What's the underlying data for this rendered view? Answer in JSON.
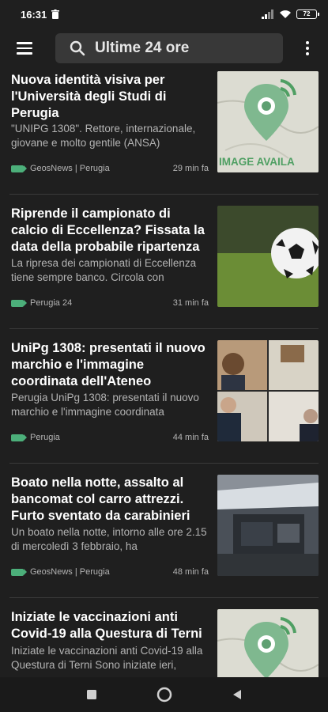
{
  "status": {
    "time": "16:31",
    "battery": "72"
  },
  "app_bar": {
    "search_label": "Ultime 24 ore"
  },
  "colors": {
    "background": "#1f1f1f",
    "search_bg": "#383838",
    "tag_green": "#4caf7a"
  },
  "articles": [
    {
      "title": "Nuova identità visiva per l'Università degli Studi di Perugia",
      "snippet": "\"UNIPG 1308\". Rettore, internazionale, giovane e molto gentile (ANSA)",
      "source": "GeosNews | Perugia",
      "time": "29 min fa",
      "image_text": "IMAGE AVAILA"
    },
    {
      "title": "Riprende il campionato di calcio di Eccellenza? Fissata la data della probabile ripartenza",
      "snippet": "La ripresa dei campionati di Eccellenza tiene sempre banco. Circola con",
      "source": "Perugia 24",
      "time": "31 min fa"
    },
    {
      "title": "UniPg 1308: presentati il nuovo marchio e l'immagine coordinata dell'Ateneo",
      "snippet": "Perugia UniPg 1308: presentati il nuovo marchio e l'immagine coordinata",
      "source": "Perugia",
      "time": "44 min fa"
    },
    {
      "title": "Boato nella notte, assalto al bancomat col carro attrezzi. Furto sventato da carabinieri",
      "snippet": "Un boato nella notte, intorno alle ore 2.15 di mercoledì 3 febbraio, ha",
      "source": "GeosNews | Perugia",
      "time": "48 min fa"
    },
    {
      "title": "Iniziate le vaccinazioni anti Covid-19 alla Questura di Terni",
      "snippet": "Iniziate le vaccinazioni anti Covid-19 alla Questura di Terni Sono iniziate ieri,",
      "source": "",
      "time": ""
    }
  ]
}
